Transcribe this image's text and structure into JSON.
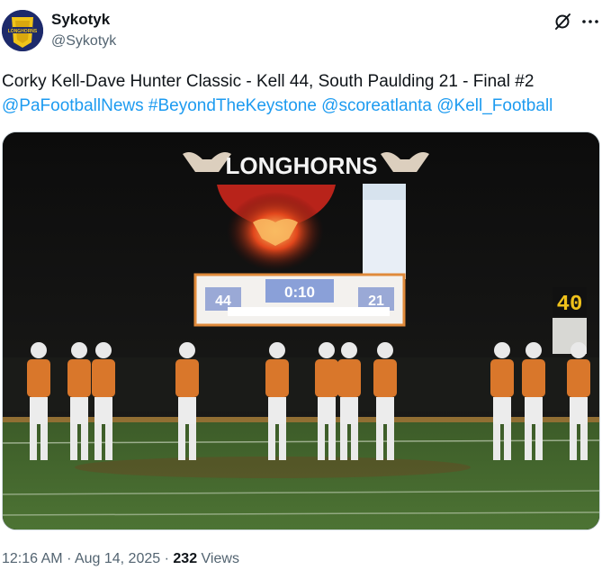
{
  "author": {
    "display_name": "Sykotyk",
    "handle": "@Sykotyk",
    "avatar_text": "LONGHORNS"
  },
  "post": {
    "text": "Corky Kell-Dave Hunter Classic - Kell 44, South Paulding 21 - Final #2",
    "links": [
      "@PaFootballNews",
      "#BeyondTheKeystone",
      "@scoreatlanta",
      "@Kell_Football"
    ]
  },
  "photo": {
    "banner_text": "LONGHORNS",
    "home_score": "44",
    "clock": "0:10",
    "away_score": "21",
    "play_clock": "40"
  },
  "meta": {
    "time": "12:16 AM",
    "separator": "·",
    "date": "Aug 14, 2025",
    "views_count": "232",
    "views_label": "Views"
  },
  "colors": {
    "link": "#1d9bf0",
    "secondary_text": "#536471",
    "jersey_orange": "#d9772b"
  },
  "icons": [
    "grok-icon",
    "more-icon"
  ]
}
